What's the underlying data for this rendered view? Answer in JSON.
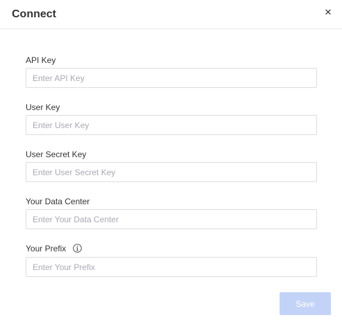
{
  "dialog": {
    "title": "Connect",
    "close_icon": "close-icon"
  },
  "fields": [
    {
      "label": "API Key",
      "placeholder": "Enter API Key",
      "value": ""
    },
    {
      "label": "User Key",
      "placeholder": "Enter User Key",
      "value": ""
    },
    {
      "label": "User Secret Key",
      "placeholder": "Enter User Secret Key",
      "value": ""
    },
    {
      "label": "Your Data Center",
      "placeholder": "Enter Your Data Center",
      "value": ""
    },
    {
      "label": "Your Prefix",
      "placeholder": "Enter Your Prefix",
      "value": "",
      "icon": "info-icon"
    }
  ],
  "actions": {
    "save_label": "Save"
  },
  "colors": {
    "save_button_disabled": "#c3d3f8",
    "input_border": "#dcdce3",
    "placeholder": "#a9a9b3"
  }
}
